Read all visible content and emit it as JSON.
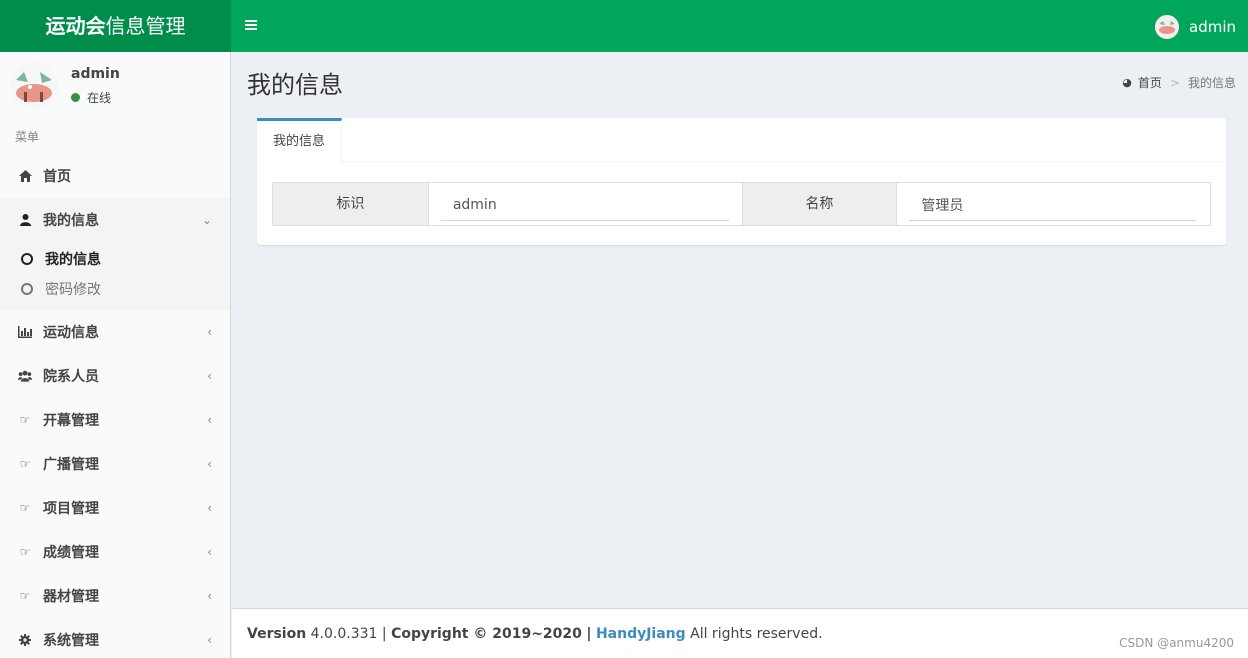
{
  "header": {
    "logo_bold": "运动会",
    "logo_rest": "信息管理",
    "user": "admin",
    "accent_color": "#00a65a",
    "logo_bg_color": "#008d4c"
  },
  "sidebar": {
    "user_name": "admin",
    "status": "在线",
    "menu_header": "菜单",
    "items": [
      {
        "label": "首页",
        "icon": "home-icon"
      },
      {
        "label": "我的信息",
        "icon": "user-icon",
        "expanded": true,
        "children": [
          {
            "label": "我的信息",
            "active": true
          },
          {
            "label": "密码修改",
            "active": false
          }
        ]
      },
      {
        "label": "运动信息",
        "icon": "bar-chart-icon"
      },
      {
        "label": "院系人员",
        "icon": "users-icon"
      },
      {
        "label": "开幕管理",
        "icon": "hand-point-icon"
      },
      {
        "label": "广播管理",
        "icon": "hand-point-icon"
      },
      {
        "label": "项目管理",
        "icon": "hand-point-icon"
      },
      {
        "label": "成绩管理",
        "icon": "hand-point-icon"
      },
      {
        "label": "器材管理",
        "icon": "hand-point-icon"
      },
      {
        "label": "系统管理",
        "icon": "gear-icon"
      }
    ]
  },
  "main": {
    "page_title": "我的信息",
    "breadcrumb": {
      "home": "首页",
      "current": "我的信息"
    },
    "tab_label": "我的信息",
    "fields": {
      "id_label": "标识",
      "id_value": "admin",
      "name_label": "名称",
      "name_value": "管理员"
    }
  },
  "footer": {
    "version_label": "Version",
    "version_value": "4.0.0.331",
    "sep": "|",
    "copyright": "Copyright © 2019~2020",
    "brand": "HandyJiang",
    "rights": "All rights reserved."
  },
  "watermark": "CSDN @anmu4200"
}
